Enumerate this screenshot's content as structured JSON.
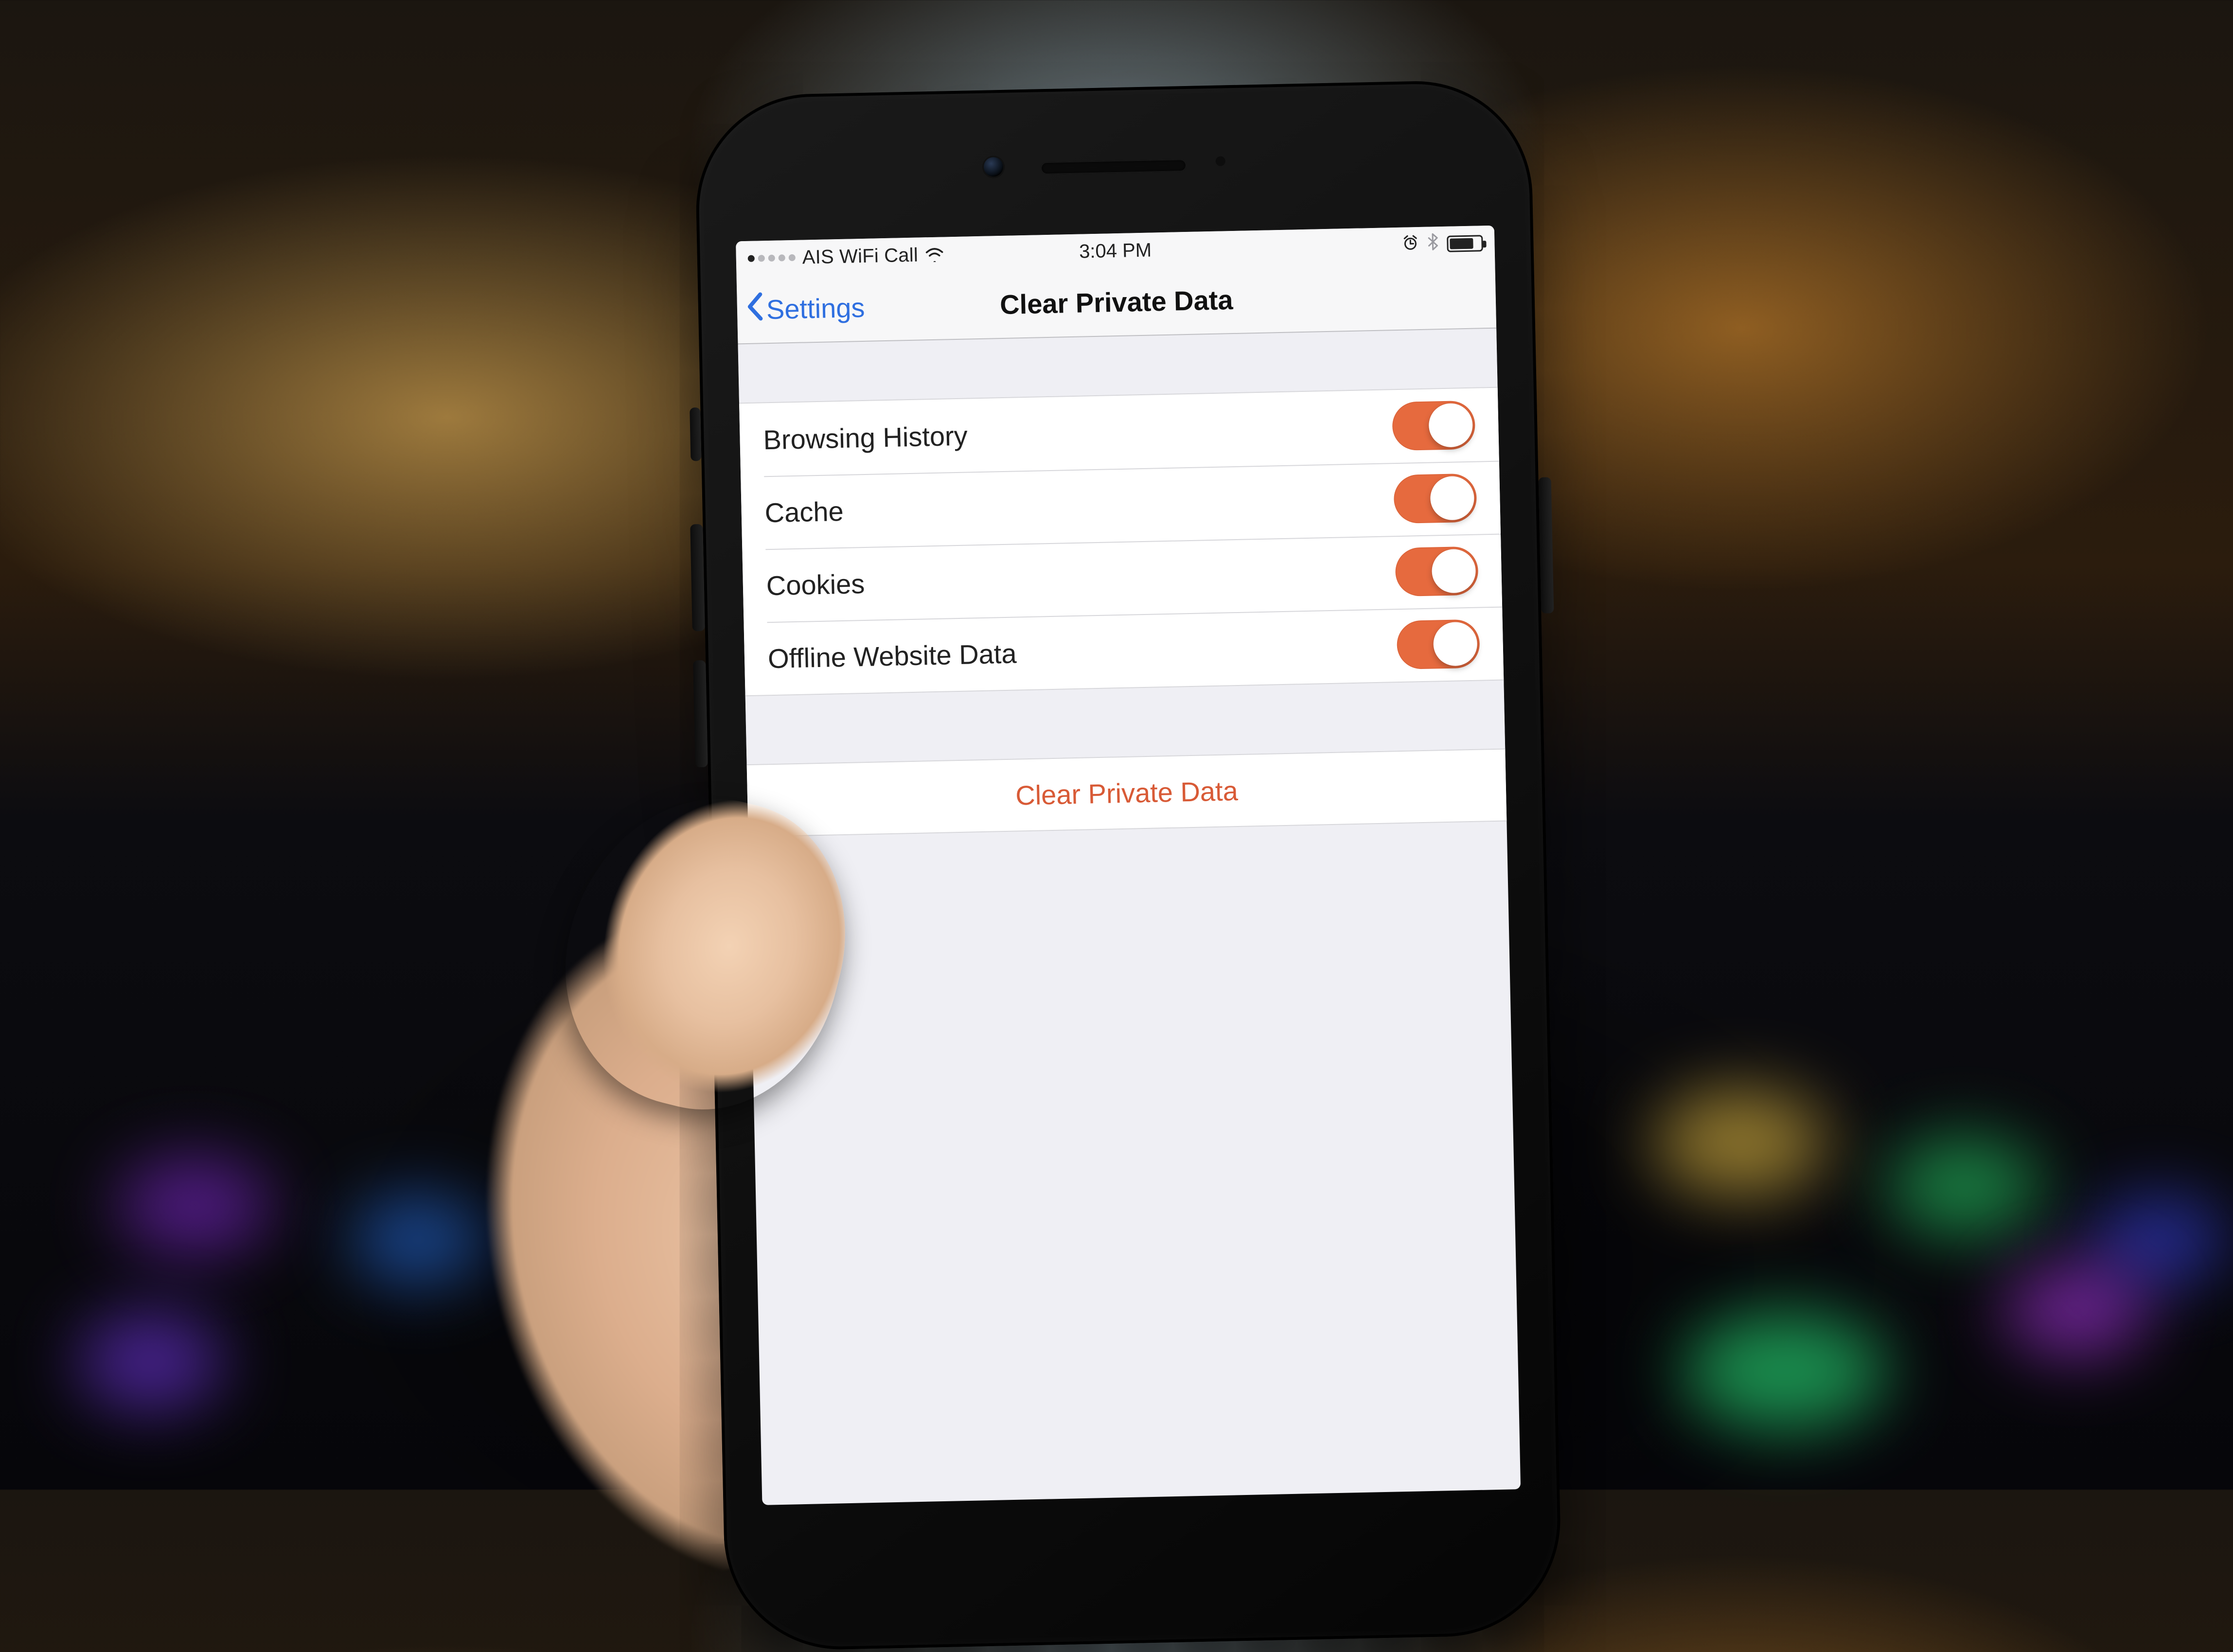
{
  "colors": {
    "accent_link": "#2f6fe0",
    "accent_danger": "#d85a36",
    "switch_on": "#e66a3e",
    "bg_grouped": "#efeff4",
    "separator": "#d7d7db"
  },
  "statusbar": {
    "carrier": "AIS WiFi Call",
    "time": "3:04 PM",
    "signal_filled": 1,
    "signal_total": 5,
    "wifi": true,
    "alarm": true,
    "bluetooth": true,
    "battery_percent_estimate": 70
  },
  "navbar": {
    "back_label": "Settings",
    "title": "Clear Private Data"
  },
  "toggles": [
    {
      "id": "browsing-history",
      "label": "Browsing History",
      "on": true
    },
    {
      "id": "cache",
      "label": "Cache",
      "on": true
    },
    {
      "id": "cookies",
      "label": "Cookies",
      "on": true
    },
    {
      "id": "offline-website-data",
      "label": "Offline Website Data",
      "on": true
    }
  ],
  "action": {
    "clear_label": "Clear Private Data"
  }
}
